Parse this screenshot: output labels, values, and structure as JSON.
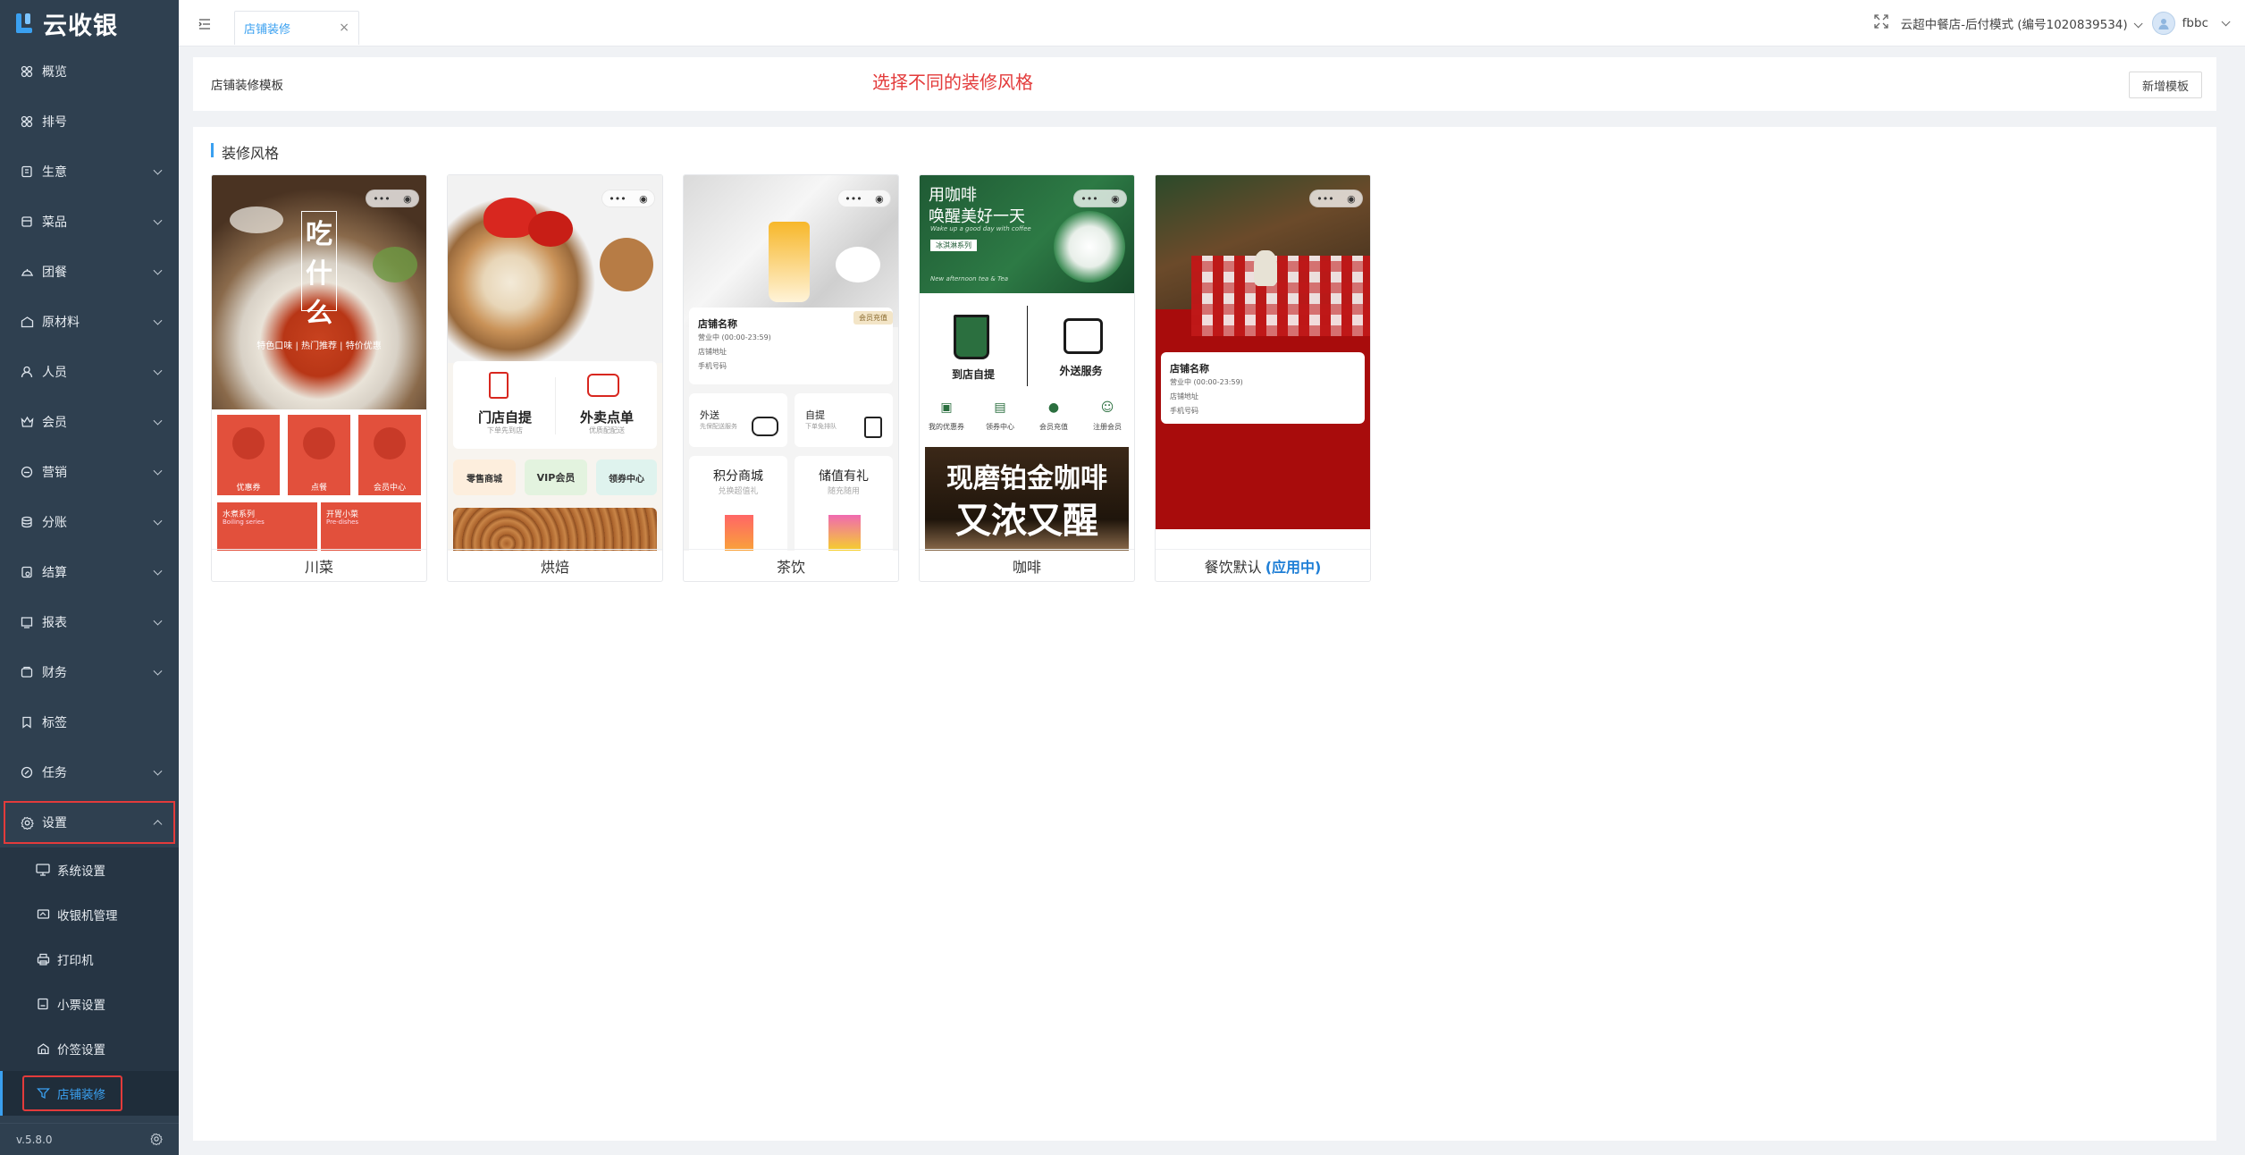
{
  "app": {
    "name": "云收银",
    "version": "v.5.8.0"
  },
  "colors": {
    "sidebar": "#2f4050",
    "accent": "#3aa0f0",
    "highlight": "#e33b3b",
    "inuse": "#1f7fd6"
  },
  "sidebar": {
    "items": [
      {
        "label": "概览",
        "icon": "dashboard-icon",
        "expandable": false
      },
      {
        "label": "排号",
        "icon": "queue-icon",
        "expandable": false
      },
      {
        "label": "生意",
        "icon": "business-icon",
        "expandable": true
      },
      {
        "label": "菜品",
        "icon": "dish-icon",
        "expandable": true
      },
      {
        "label": "团餐",
        "icon": "group-meal-icon",
        "expandable": true
      },
      {
        "label": "原材料",
        "icon": "material-icon",
        "expandable": true
      },
      {
        "label": "人员",
        "icon": "staff-icon",
        "expandable": true
      },
      {
        "label": "会员",
        "icon": "member-icon",
        "expandable": true
      },
      {
        "label": "营销",
        "icon": "marketing-icon",
        "expandable": true
      },
      {
        "label": "分账",
        "icon": "ledger-icon",
        "expandable": true
      },
      {
        "label": "结算",
        "icon": "settlement-icon",
        "expandable": true
      },
      {
        "label": "报表",
        "icon": "report-icon",
        "expandable": true
      },
      {
        "label": "财务",
        "icon": "finance-icon",
        "expandable": true
      },
      {
        "label": "标签",
        "icon": "tag-icon",
        "expandable": false
      },
      {
        "label": "任务",
        "icon": "task-icon",
        "expandable": true
      },
      {
        "label": "设置",
        "icon": "settings-icon",
        "expandable": true,
        "open": true
      }
    ],
    "settings_sub": [
      {
        "label": "系统设置",
        "icon": "monitor-icon"
      },
      {
        "label": "收银机管理",
        "icon": "cashier-icon"
      },
      {
        "label": "打印机",
        "icon": "printer-icon"
      },
      {
        "label": "小票设置",
        "icon": "receipt-icon"
      },
      {
        "label": "价签设置",
        "icon": "price-tag-icon"
      },
      {
        "label": "店铺装修",
        "icon": "decorate-icon",
        "active": true
      }
    ]
  },
  "topbar": {
    "tab": "店铺装修",
    "store": "云超中餐店-后付模式 (编号1020839534)",
    "user": "fbbc"
  },
  "header_card": {
    "title": "店铺装修模板",
    "hint": "选择不同的装修风格",
    "new_button": "新增模板"
  },
  "styles_card": {
    "section_title": "装修风格",
    "in_use_label": "(应用中)",
    "templates": [
      {
        "name": "川菜",
        "banner": [
          "吃",
          "什",
          "么"
        ],
        "tagline": "特色口味 | 热门推荐 | 特价优惠",
        "icons": [
          "优惠券",
          "点餐",
          "会员中心"
        ],
        "cards": [
          {
            "title": "水煮系列",
            "sub": "Boiling series"
          },
          {
            "title": "开胃小菜",
            "sub": "Pre-dishes"
          }
        ]
      },
      {
        "name": "烘焙",
        "services": [
          {
            "title": "门店自提",
            "sub": "下单先到店"
          },
          {
            "title": "外卖点单",
            "sub": "优质配配送"
          }
        ],
        "chips": [
          "零售商城",
          "VIP会员",
          "领券中心"
        ]
      },
      {
        "name": "茶饮",
        "store_name": "店铺名称",
        "badge": "会员充值",
        "info": [
          "营业中 (00:00-23:59)",
          "店铺地址",
          "手机号码"
        ],
        "services": [
          {
            "title": "外送",
            "sub": "先保配送服务"
          },
          {
            "title": "自提",
            "sub": "下单免排队"
          }
        ],
        "tiles": [
          {
            "title": "积分商城",
            "sub": "兑换超值礼"
          },
          {
            "title": "储值有礼",
            "sub": "随充随用"
          }
        ]
      },
      {
        "name": "咖啡",
        "banner_lines": [
          "用咖啡",
          "唤醒美好一天"
        ],
        "banner_en": "Wake up a good day with coffee",
        "banner_tag": "冰淇淋系列",
        "banner_footer": "New afternoon tea & Tea",
        "services": [
          "到店自提",
          "外送服务"
        ],
        "shortcuts": [
          "我的优惠券",
          "领券中心",
          "会员充值",
          "注册会员"
        ],
        "promo": [
          "现磨铂金咖啡",
          "又浓又醒"
        ]
      },
      {
        "name": "餐饮默认",
        "in_use": true,
        "store_name": "店铺名称",
        "info": [
          "营业中 (00:00-23:59)",
          "店铺地址",
          "手机号码"
        ]
      }
    ]
  }
}
